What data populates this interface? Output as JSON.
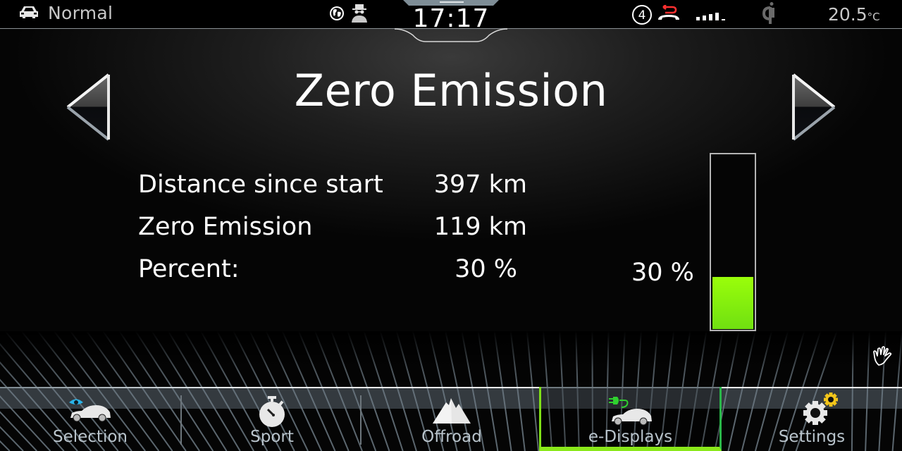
{
  "status_bar": {
    "drive_mode": "Normal",
    "drive_mode_icon": "car-icon",
    "icons": [
      "globe-icon",
      "privacy-agent-icon",
      "message-count-badge",
      "missed-call-icon",
      "signal-strength-icon",
      "wireless-charging-qi-icon"
    ],
    "message_count": "4",
    "clock": "17:17",
    "temperature": "20.5",
    "temperature_unit": "°C"
  },
  "page": {
    "title": "Zero Emission",
    "prev_icon": "arrow-left-icon",
    "next_icon": "arrow-right-icon"
  },
  "stats": [
    {
      "label": "Distance since start",
      "value": "397 km"
    },
    {
      "label": "Zero Emission",
      "value": "119 km"
    },
    {
      "label": "Percent:",
      "value": "30 %"
    }
  ],
  "gauge": {
    "label": "30 %",
    "percent": 30,
    "fill_color": "#8ef40d"
  },
  "gesture_icon": "hand-gesture-icon",
  "nav": {
    "items": [
      {
        "label": "Selection",
        "icon": "car-eye-icon",
        "active": false
      },
      {
        "label": "Sport",
        "icon": "stopwatch-icon",
        "active": false
      },
      {
        "label": "Offroad",
        "icon": "mountain-icon",
        "active": false
      },
      {
        "label": "e-Displays",
        "icon": "car-plug-icon",
        "active": true
      },
      {
        "label": "Settings",
        "icon": "gear-icon",
        "active": false
      }
    ],
    "active_color": "#8ae81a"
  }
}
